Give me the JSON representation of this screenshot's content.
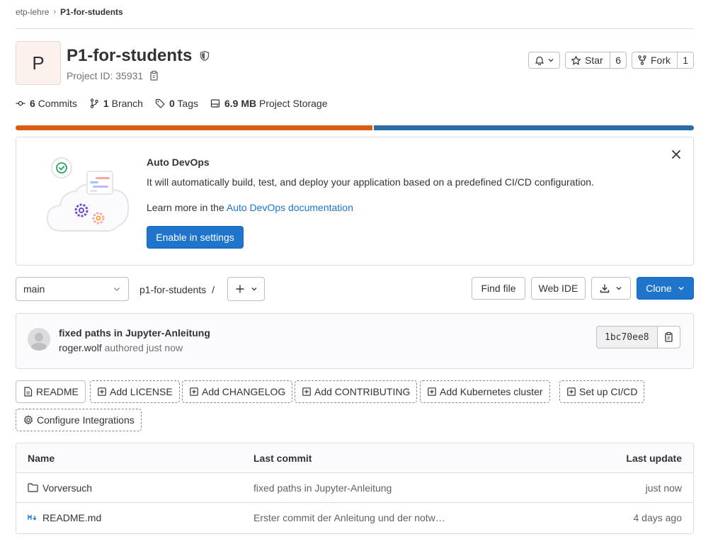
{
  "breadcrumb": {
    "group": "etp-lehre",
    "project": "P1-for-students"
  },
  "project": {
    "avatar_letter": "P",
    "name": "P1-for-students",
    "id_label": "Project ID: 35931"
  },
  "actions": {
    "star_label": "Star",
    "star_count": "6",
    "fork_label": "Fork",
    "fork_count": "1"
  },
  "stats": {
    "commits_count": "6",
    "commits_label": "Commits",
    "branch_count": "1",
    "branch_label": "Branch",
    "tags_count": "0",
    "tags_label": "Tags",
    "storage_size": "6.9 MB",
    "storage_label": "Project Storage"
  },
  "language_bar": {
    "segments": [
      {
        "color": "#d65f13",
        "fraction": 0.527
      },
      {
        "color": "#2d6ba3",
        "fraction": 0.473
      }
    ]
  },
  "auto_devops": {
    "title": "Auto DevOps",
    "description": "It will automatically build, test, and deploy your application based on a predefined CI/CD configuration.",
    "learn_prefix": "Learn more in the",
    "learn_link": "Auto DevOps documentation",
    "enable_button": "Enable in settings"
  },
  "toolbar": {
    "branch": "main",
    "path": "p1-for-students",
    "path_sep": "/",
    "find_file": "Find file",
    "web_ide": "Web IDE",
    "clone": "Clone"
  },
  "last_commit": {
    "message": "fixed paths in Jupyter-Anleitung",
    "author": "roger.wolf",
    "authored": "authored just now",
    "sha": "1bc70ee8"
  },
  "quick_actions": {
    "readme": "README",
    "add_license": "Add LICENSE",
    "add_changelog": "Add CHANGELOG",
    "add_contributing": "Add CONTRIBUTING",
    "add_kubernetes": "Add Kubernetes cluster",
    "setup_cicd": "Set up CI/CD",
    "configure_integrations": "Configure Integrations"
  },
  "files": {
    "headers": {
      "name": "Name",
      "last_commit": "Last commit",
      "last_update": "Last update"
    },
    "rows": [
      {
        "icon": "folder-icon",
        "name": "Vorversuch",
        "commit": "fixed paths in Jupyter-Anleitung",
        "updated": "just now"
      },
      {
        "icon": "markdown-icon",
        "name": "README.md",
        "commit": "Erster commit der Anleitung und der notw…",
        "updated": "4 days ago"
      }
    ]
  },
  "colors": {
    "primary": "#1f75cb",
    "text": "#333238",
    "muted": "#737278"
  }
}
